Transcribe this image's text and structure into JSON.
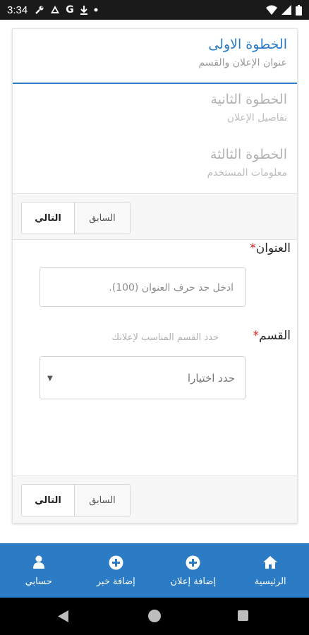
{
  "status_bar": {
    "time": "3:34",
    "left_icons": [
      "wrench-icon",
      "recycle-icon",
      "google-icon",
      "download-icon",
      "dot-icon"
    ],
    "right_icons": [
      "wifi-icon",
      "signal-icon",
      "battery-icon"
    ]
  },
  "steps": [
    {
      "title": "الخطوة الاولى",
      "subtitle": "عنوان الإعلان والقسم"
    },
    {
      "title": "الخطوة الثانية",
      "subtitle": "تفاصيل الإعلان"
    },
    {
      "title": "الخطوة الثالثة",
      "subtitle": "معلومات المستخدم"
    }
  ],
  "nav_buttons": {
    "next_label": "التالي",
    "prev_label": "السابق"
  },
  "form": {
    "title_label": "العنوان",
    "required_mark": "*",
    "title_placeholder": "ادخل حد حرف العنوان (100).",
    "category_label": "القسم",
    "category_hint": "حدد القسم المناسب لإعلانك",
    "category_value": "حدد اختيارا"
  },
  "bottom_nav": {
    "items": [
      {
        "label": "الرئيسية",
        "icon": "home-icon"
      },
      {
        "label": "إضافة إعلان",
        "icon": "plus-circle-icon"
      },
      {
        "label": "إضافة خبر",
        "icon": "plus-circle-icon"
      },
      {
        "label": "حسابي",
        "icon": "user-icon"
      }
    ]
  },
  "colors": {
    "accent": "#2c7bc5",
    "required": "#e02020",
    "statusbar": "#1a1a1a"
  }
}
